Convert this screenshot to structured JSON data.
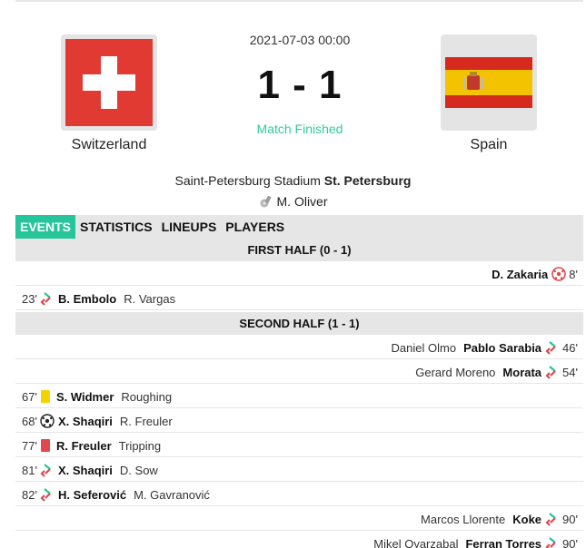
{
  "match": {
    "datetime": "2021-07-03 00:00",
    "score": "1 - 1",
    "status": "Match Finished",
    "home": {
      "name": "Switzerland",
      "flag": "switzerland-flag-icon"
    },
    "away": {
      "name": "Spain",
      "flag": "spain-flag-icon"
    },
    "venue": {
      "stadium": "Saint-Petersburg Stadium",
      "city": "St. Petersburg"
    },
    "referee": "M. Oliver"
  },
  "tabs": [
    {
      "label": "EVENTS",
      "active": true
    },
    {
      "label": "STATISTICS",
      "active": false
    },
    {
      "label": "LINEUPS",
      "active": false
    },
    {
      "label": "PLAYERS",
      "active": false
    }
  ],
  "halves": {
    "first": "FIRST HALF (0 - 1)",
    "second": "SECOND HALF (1 - 1)"
  },
  "events": [
    {
      "side": "away",
      "minute": "8'",
      "type": "goal",
      "player": "D. Zakaria",
      "detail": ""
    },
    {
      "side": "home",
      "minute": "23'",
      "type": "substitution",
      "player": "B. Embolo",
      "detail": "R. Vargas"
    },
    {
      "side": "away",
      "minute": "46'",
      "type": "substitution",
      "player": "Pablo Sarabia",
      "detail": "Daniel Olmo"
    },
    {
      "side": "away",
      "minute": "54'",
      "type": "substitution",
      "player": "Morata",
      "detail": "Gerard Moreno"
    },
    {
      "side": "home",
      "minute": "67'",
      "type": "yellow-card",
      "player": "S. Widmer",
      "detail": "Roughing"
    },
    {
      "side": "home",
      "minute": "68'",
      "type": "goal",
      "player": "X. Shaqiri",
      "detail": "R. Freuler"
    },
    {
      "side": "home",
      "minute": "77'",
      "type": "red-card",
      "player": "R. Freuler",
      "detail": "Tripping"
    },
    {
      "side": "home",
      "minute": "81'",
      "type": "substitution",
      "player": "X. Shaqiri",
      "detail": "D. Sow"
    },
    {
      "side": "home",
      "minute": "82'",
      "type": "substitution",
      "player": "H. Seferović",
      "detail": "M. Gavranović"
    },
    {
      "side": "away",
      "minute": "90'",
      "type": "substitution",
      "player": "Koke",
      "detail": "Marcos Llorente"
    },
    {
      "side": "away",
      "minute": "90'",
      "type": "substitution",
      "player": "Ferran Torres",
      "detail": "Mikel Oyarzabal"
    }
  ],
  "colors": {
    "accent": "#27c59a",
    "status": "#2ecc9a",
    "yellow_card": "#f4d400",
    "red_card": "#e0484d",
    "sub_in": "#27c59a",
    "sub_out": "#e0484d"
  }
}
